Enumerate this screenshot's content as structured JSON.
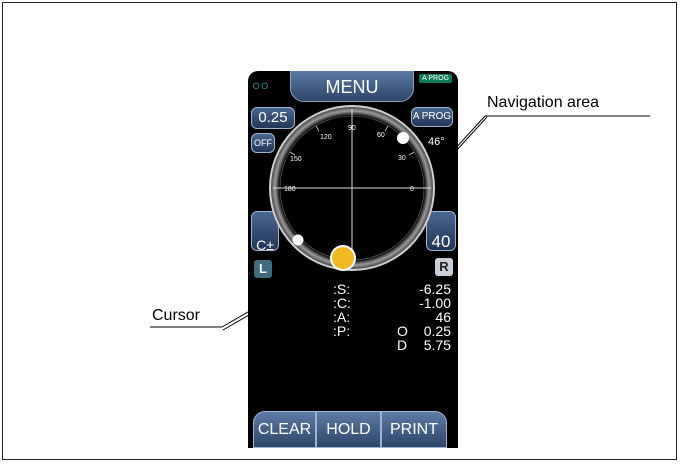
{
  "device": {
    "menu_title": "MENU",
    "aprog_badge": "A PROG",
    "glasses_icon": "glasses-icon",
    "left_buttons": {
      "step": "0.25",
      "off": "OFF",
      "c_pm": "C±"
    },
    "right_buttons": {
      "aprog": "A PROG",
      "value": "40"
    },
    "angle_readout": "46°",
    "dial_labels": [
      "90",
      "60",
      "30",
      "0",
      "180",
      "150",
      "120"
    ],
    "side_badges": {
      "left": "L",
      "right": "R"
    },
    "readings": [
      {
        "label": ":S:",
        "value": "-6.25"
      },
      {
        "label": ":C:",
        "value": "-1.00"
      },
      {
        "label": ":A:",
        "value": "46"
      },
      {
        "label": ":P:",
        "sub": "O",
        "value": "0.25"
      },
      {
        "label": "",
        "sub": "D",
        "value": "5.75"
      }
    ],
    "bottom_buttons": {
      "clear": "CLEAR",
      "hold": "HOLD",
      "print": "PRINT"
    },
    "colors": {
      "cursor": "#f2b824",
      "button_top": "#4a6691",
      "badge_green": "#0f7a55"
    }
  },
  "callouts": {
    "navigation": "Navigation area",
    "cursor": "Cursor"
  }
}
